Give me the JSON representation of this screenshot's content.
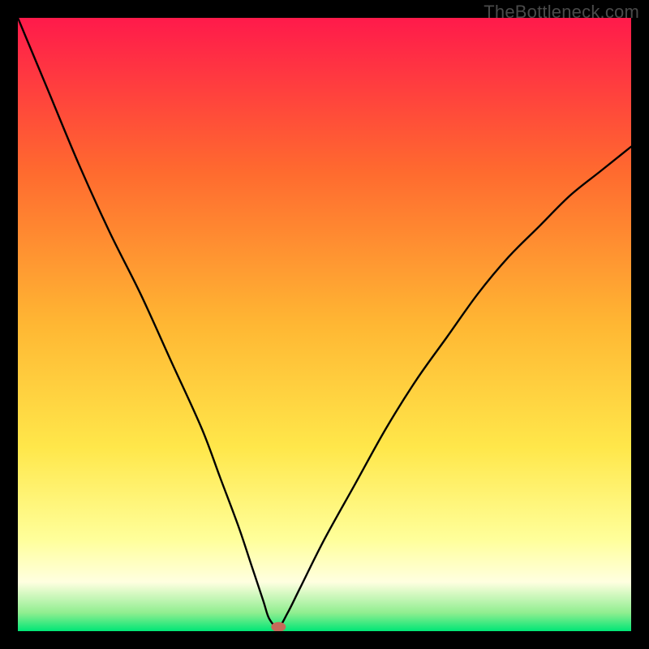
{
  "watermark": "TheBottleneck.com",
  "chart_data": {
    "type": "line",
    "title": "",
    "xlabel": "",
    "ylabel": "",
    "xlim": [
      0,
      100
    ],
    "ylim": [
      0,
      100
    ],
    "grid": false,
    "legend": false,
    "background_gradient": {
      "stops": [
        {
          "offset": 0,
          "color": "#ff1a4b"
        },
        {
          "offset": 25,
          "color": "#ff6a2f"
        },
        {
          "offset": 50,
          "color": "#ffb733"
        },
        {
          "offset": 70,
          "color": "#ffe74a"
        },
        {
          "offset": 85,
          "color": "#ffff9a"
        },
        {
          "offset": 92,
          "color": "#ffffe0"
        },
        {
          "offset": 97,
          "color": "#90ee90"
        },
        {
          "offset": 100,
          "color": "#00e676"
        }
      ]
    },
    "marker": {
      "x": 42.5,
      "y": 0.7,
      "color": "#c66a5a"
    },
    "series": [
      {
        "name": "bottleneck-curve",
        "color": "#000000",
        "x": [
          0,
          5,
          10,
          15,
          20,
          25,
          30,
          33,
          36,
          38,
          40,
          41,
          42.5,
          44,
          46,
          50,
          55,
          60,
          65,
          70,
          75,
          80,
          85,
          90,
          95,
          100
        ],
        "y": [
          100,
          88,
          76,
          65,
          55,
          44,
          33,
          25,
          17,
          11,
          5,
          2,
          0.7,
          3,
          7,
          15,
          24,
          33,
          41,
          48,
          55,
          61,
          66,
          71,
          75,
          79
        ]
      }
    ]
  }
}
